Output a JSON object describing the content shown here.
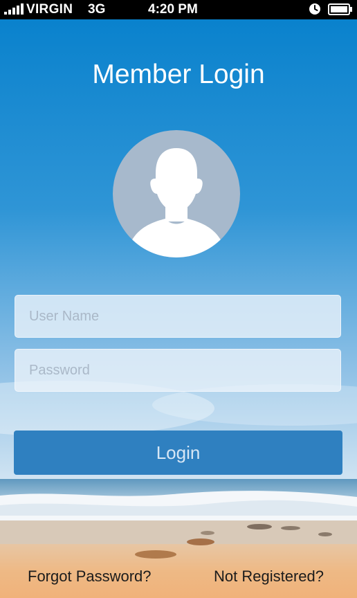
{
  "status_bar": {
    "carrier": "VIRGIN",
    "network": "3G",
    "time": "4:20 PM",
    "signal_icon": "signal-bars-icon",
    "alarm_icon": "alarm-clock-icon",
    "battery_icon": "battery-icon"
  },
  "login": {
    "title": "Member Login",
    "avatar_icon": "user-silhouette-icon",
    "username_placeholder": "User Name",
    "password_placeholder": "Password",
    "login_label": "Login",
    "forgot_label": "Forgot Password?",
    "register_label": "Not Registered?"
  },
  "colors": {
    "sky_top": "#0680cc",
    "sky_bottom": "#cfe3f2",
    "button": "#2f80c0",
    "avatar_circle": "#a7b9cc"
  }
}
